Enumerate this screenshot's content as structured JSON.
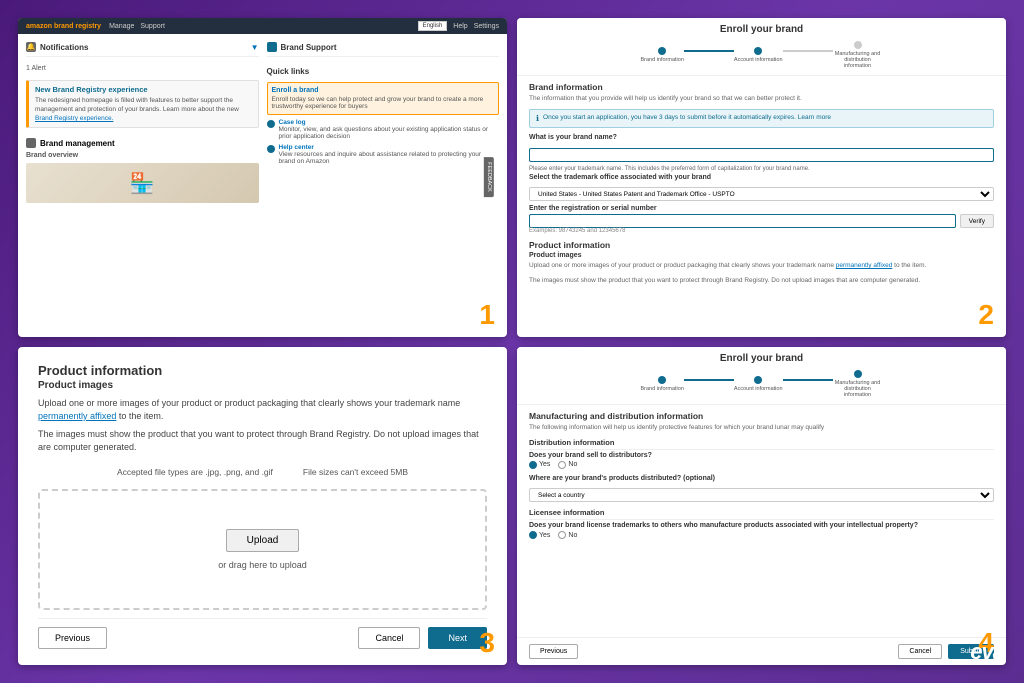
{
  "panel1": {
    "topbar": {
      "logo": "amazon brand registry",
      "links": [
        "Manage",
        "Support"
      ],
      "lang": "English",
      "help": "Help",
      "settings": "Settings"
    },
    "notifications": {
      "title": "Notifications",
      "alert_count": "1 Alert",
      "notification": {
        "title": "New Brand Registry experience",
        "text": "The redesigned homepage is filled with features to better support the management and protection of your brands. Learn more about the new Brand Registry experience.",
        "link_text": "Brand Registry experience"
      }
    },
    "brand_management": {
      "title": "Brand management",
      "sub": "Brand overview"
    },
    "brand_support": {
      "title": "Brand Support",
      "quick_links": "Quick links",
      "items": [
        {
          "title": "Enroll a brand",
          "text": "Enroll today so we can help protect and grow your brand to create a more trustworthy experience for buyers"
        },
        {
          "title": "Case log",
          "text": "Monitor, view, and ask questions about your existing application status or prior application decision"
        },
        {
          "title": "Help center",
          "text": "View resources and inquire about assistance related to protecting your brand on Amazon"
        }
      ]
    }
  },
  "panel2": {
    "title": "Enroll your brand",
    "steps": [
      {
        "label": "Brand information",
        "state": "completed"
      },
      {
        "label": "Account information",
        "state": "active"
      },
      {
        "label": "Manufacturing and distribution information",
        "state": "inactive"
      }
    ],
    "brand_information": {
      "title": "Brand information",
      "desc": "The information that you provide will help us identify your brand so that we can better protect it.",
      "info_box": "Once you start an application, you have 3 days to submit before it automatically expires. Learn more",
      "brand_name_label": "What is your brand name?",
      "brand_name_hint": "Please enter your trademark name. This includes the preferred form of capitalization for your brand name.",
      "trademark_label": "Select the trademark office associated with your brand",
      "trademark_value": "United States - United States Patent and Trademark Office - USPTO",
      "serial_label": "Enter the registration or serial number",
      "serial_placeholder": "",
      "verify_btn": "Verify",
      "example": "Examples: 98743245 and 12345678",
      "product_info": {
        "title": "Product information",
        "subtitle": "Product images",
        "desc1": "Upload one or more images of your product or product packaging that clearly shows your trademark name permanently affixed to the item.",
        "desc2": "The images must show the product that you want to protect through Brand Registry. Do not upload images that are computer generated."
      }
    }
  },
  "panel3": {
    "title": "Product information",
    "subtitle": "Product images",
    "desc1": "Upload one or more images of your product or product packaging that clearly shows your trademark name",
    "link_text": "permanently affixed",
    "desc1_end": "to the item.",
    "desc2": "The images must show the product that you want to protect through Brand Registry. Do not upload images that are computer generated.",
    "file_types": "Accepted file types are .jpg, .png, and .gif",
    "file_size": "File sizes can't exceed 5MB",
    "upload_btn": "Upload",
    "or_text": "or drag here to upload",
    "prev_btn": "Previous",
    "cancel_btn": "Cancel",
    "next_btn": "Next"
  },
  "panel4": {
    "title": "Enroll your brand",
    "steps": [
      {
        "label": "Brand information",
        "state": "completed"
      },
      {
        "label": "Account information",
        "state": "completed"
      },
      {
        "label": "Manufacturing and distribution information",
        "state": "active"
      }
    ],
    "section_title": "Manufacturing and distribution information",
    "section_desc": "The following information will help us identify protective features for which your brand lunar may qualify",
    "distribution": {
      "title": "Distribution information",
      "distributors_label": "Does your brand sell to distributors?",
      "distributors_yes": "Yes",
      "distributors_no": "No",
      "where_label": "Where are your brand's products distributed? (optional)",
      "where_placeholder": "Select a country"
    },
    "license": {
      "title": "Licensee information",
      "license_label": "Does your brand license trademarks to others who manufacture products associated with your intellectual property?",
      "license_yes": "Yes",
      "license_no": "No"
    },
    "prev_btn": "Previous",
    "cancel_btn": "Cancel",
    "submit_btn": "Submit"
  },
  "eva_logo": "eva"
}
